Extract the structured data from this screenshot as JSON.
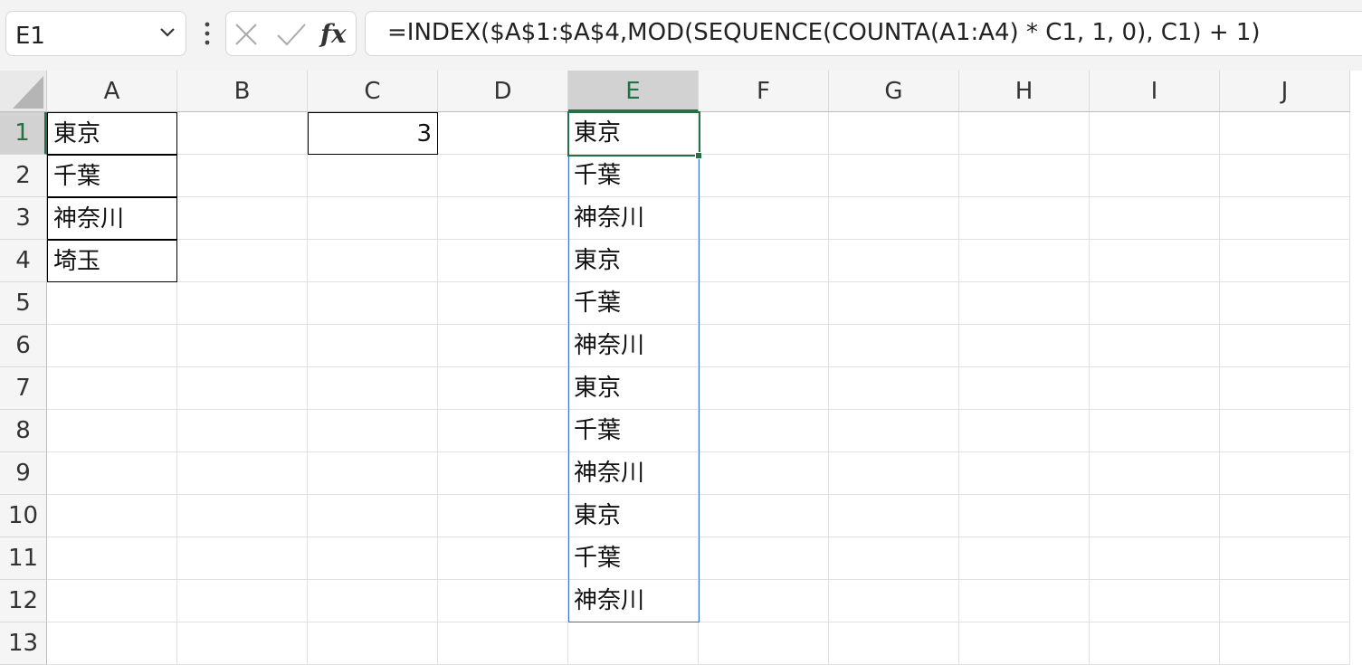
{
  "name_box": {
    "value": "E1"
  },
  "formula_bar": {
    "formula": "=INDEX($A$1:$A$4,MOD(SEQUENCE(COUNTA(A1:A4) * C1, 1, 0), C1) + 1)"
  },
  "icons": [
    "chevron-down-icon",
    "more-vertical-icon",
    "cancel-icon",
    "check-icon",
    "function-icon"
  ],
  "columns": [
    "A",
    "B",
    "C",
    "D",
    "E",
    "F",
    "G",
    "H",
    "I",
    "J"
  ],
  "rows": [
    "1",
    "2",
    "3",
    "4",
    "5",
    "6",
    "7",
    "8",
    "9",
    "10",
    "11",
    "12",
    "13"
  ],
  "selected_cell": {
    "column": "E",
    "row": "1"
  },
  "cells": {
    "A1": "東京",
    "A2": "千葉",
    "A3": "神奈川",
    "A4": "埼玉",
    "C1": "3",
    "E1": "東京",
    "E2": "千葉",
    "E3": "神奈川",
    "E4": "東京",
    "E5": "千葉",
    "E6": "神奈川",
    "E7": "東京",
    "E8": "千葉",
    "E9": "神奈川",
    "E10": "東京",
    "E11": "千葉",
    "E12": "神奈川"
  },
  "colors": {
    "accent_green": "#217346",
    "spill_blue": "#3a6fd8"
  }
}
